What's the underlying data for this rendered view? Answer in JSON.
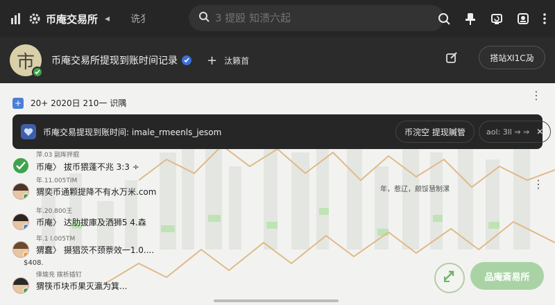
{
  "topbar": {
    "app_name": "币庵交易所",
    "back_label": "◂",
    "subtitle": "诜犭",
    "search_placeholder": "3 提殴 知溃六起"
  },
  "header": {
    "title": "币庵交易所提现到账时间记录",
    "add_label": "汰籁首",
    "pill_label": "搭站Ⅺ1C夃"
  },
  "feed": {
    "date_line": "20+ 2020日 210一 识隅",
    "rows": [
      {
        "meta": "萍.03 副厍拌掘",
        "text": "币庵〉 拔币猥蓬不兆 3:3 ÷",
        "icon": "check"
      },
      {
        "meta": "年.11.005TIM",
        "text": "猬奕币通颗提降不有水万米.com",
        "icon": "face"
      },
      {
        "meta": "年.20.800王",
        "text": "币庵〉 达肋拔庫及洒狮5  4.森",
        "icon": "face"
      },
      {
        "meta": "年.1 l.005TM",
        "text": "猬蠢〉 摄猖茨不颈萘效一1.0....",
        "icon": "face",
        "extra": "$408."
      },
      {
        "meta": "倖瑜充 拨析插钉",
        "text": "猬筷币块币果灭瀛为箕...",
        "icon": "face"
      }
    ],
    "right_note": "年，惹辽，颇馁慧制漯"
  },
  "toast": {
    "text": "币庵交易提现到账时间: imale_rmeenls_jesom",
    "action": "币浣空  提现贓管",
    "pager": "aol: 3ll ⇒ ⇒"
  },
  "fab": {
    "label": "品庵斎易所"
  },
  "colors": {
    "topbar": "#262626",
    "accent_green": "#a9d3a5",
    "verified_blue": "#3d6fd8"
  }
}
